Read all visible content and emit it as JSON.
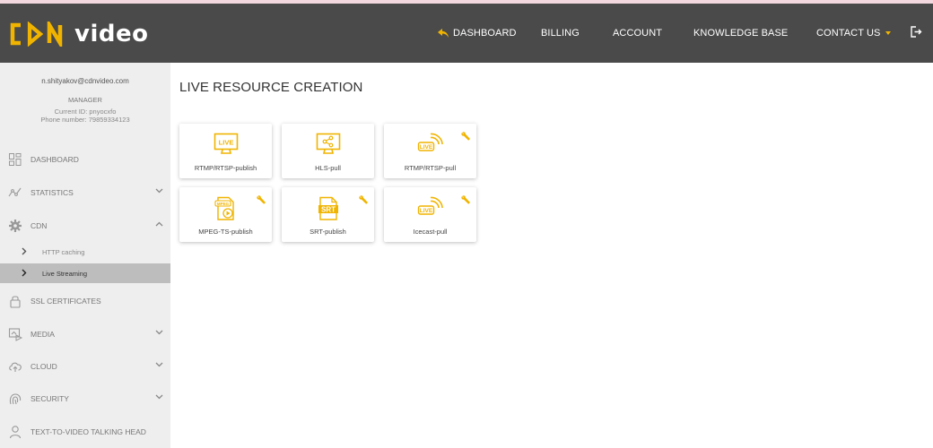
{
  "brand": {
    "logo_text": "video",
    "accent": "#f0b400",
    "header_bg": "#4a4a4a",
    "sidebar_bg": "#eeeeee"
  },
  "nav": {
    "dashboard": "DASHBOARD",
    "billing": "BILLING",
    "account": "ACCOUNT",
    "knowledge_base": "KNOWLEDGE BASE",
    "contact_us": "CONTACT US"
  },
  "user": {
    "email": "n.shityakov@cdnvideo.com",
    "role": "MANAGER",
    "current_id": "Current ID: pnyocxfo",
    "phone": "Phone number: 79859334123"
  },
  "sidebar": {
    "dashboard": "DASHBOARD",
    "statistics": "STATISTICS",
    "cdn": "CDN",
    "http_caching": "HTTP caching",
    "live_streaming": "Live Streaming",
    "ssl": "SSL CERTIFICATES",
    "media": "MEDIA",
    "cloud": "CLOUD",
    "security": "SECURITY",
    "ttv": "TEXT-TO-VIDEO TALKING HEAD"
  },
  "main": {
    "title": "LIVE RESOURCE CREATION",
    "cards": [
      {
        "label": "RTMP/RTSP-publish",
        "icon": "live-monitor-icon",
        "beta": false
      },
      {
        "label": "HLS-pull",
        "icon": "share-monitor-icon",
        "beta": false
      },
      {
        "label": "RTMP/RTSP-pull",
        "icon": "live-signal-icon",
        "beta": true
      },
      {
        "label": "MPEG-TS-publish",
        "icon": "mpeg-file-icon",
        "beta": true
      },
      {
        "label": "SRT-publish",
        "icon": "srt-file-icon",
        "beta": true
      },
      {
        "label": "Icecast-pull",
        "icon": "live-signal-icon",
        "beta": true
      }
    ]
  }
}
